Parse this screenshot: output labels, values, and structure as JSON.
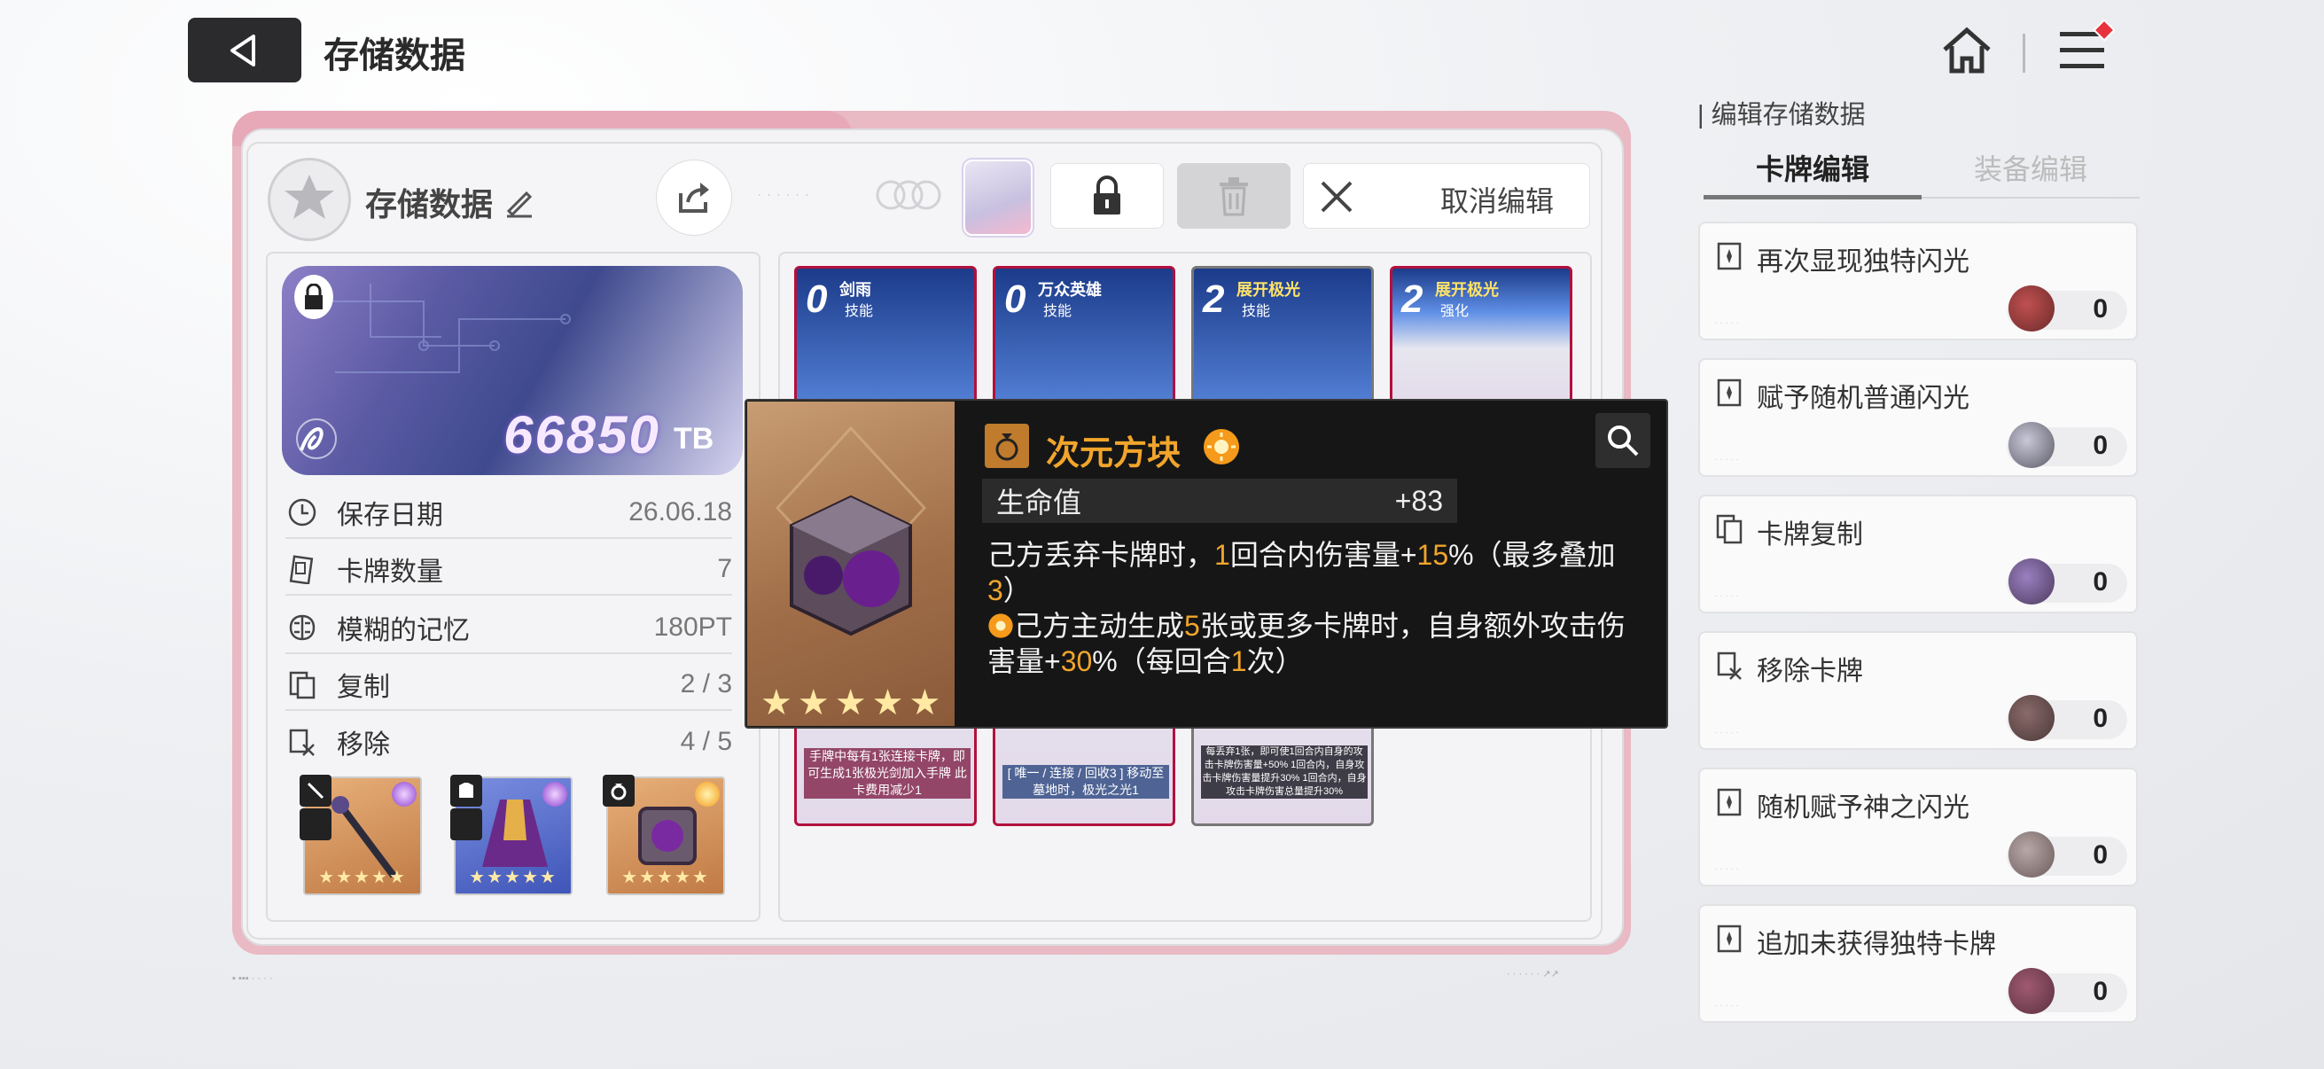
{
  "header": {
    "title": "存储数据"
  },
  "panel": {
    "save_name": "存储数据",
    "cancel_edit": "取消编辑"
  },
  "banner": {
    "value": "66850",
    "unit": "TB"
  },
  "stats": [
    {
      "label": "保存日期",
      "value": "26.06.18",
      "icon": "clock-icon"
    },
    {
      "label": "卡牌数量",
      "value": "7",
      "icon": "cards-icon"
    },
    {
      "label": "模糊的记忆",
      "value": "180PT",
      "icon": "brain-icon"
    },
    {
      "label": "复制",
      "value": "2 / 3",
      "icon": "copy-icon"
    },
    {
      "label": "移除",
      "value": "4 / 5",
      "icon": "remove-icon"
    }
  ],
  "equipment": [
    {
      "name": "staff",
      "stars": "★★★★★"
    },
    {
      "name": "robe",
      "stars": "★★★★★"
    },
    {
      "name": "cube",
      "stars": "★★★★★"
    }
  ],
  "cards": [
    {
      "cost": "0",
      "name": "剑雨",
      "type": "技能",
      "desc": "手牌中每有1张连接卡牌，即可生成1张极光剑加入手牌 此卡费用减少1"
    },
    {
      "cost": "0",
      "name": "万众英雄",
      "type": "技能",
      "desc": "[ 唯一 / 连接 / 回收3 ] 移动至墓地时，极光之光1"
    },
    {
      "cost": "2",
      "name": "展开极光",
      "type": "技能",
      "desc": "每丢弃1张，即可使1回合内自身的攻击卡牌伤害量+50% 1回合内，自身攻击卡牌伤害量提升30% 1回合内，自身攻击卡牌伤害总量提升30%"
    },
    {
      "cost": "2",
      "name": "展开极光",
      "type": "强化",
      "desc": ""
    }
  ],
  "tooltip": {
    "name": "次元方块",
    "stars": "★★★★★",
    "stat_label": "生命值",
    "stat_value": "+83",
    "line1_a": "己方丢弃卡牌时，",
    "line1_n1": "1",
    "line1_b": "回合内伤害量+",
    "line1_n2": "15",
    "line1_c": "%（最多叠加",
    "line1_n3": "3",
    "line1_d": "）",
    "line2_a": "己方主动生成",
    "line2_n1": "5",
    "line2_b": "张或更多卡牌时，自身额外攻击伤害量+",
    "line2_n2": "30",
    "line2_c": "%（每回合",
    "line2_n3": "1",
    "line2_d": "次）"
  },
  "right_panel": {
    "title": "编辑存储数据",
    "tab_active": "卡牌编辑",
    "tab_inactive": "装备编辑",
    "options": [
      {
        "label": "再次显现独特闪光",
        "count": "0",
        "gem": "#6b2a2a"
      },
      {
        "label": "赋予随机普通闪光",
        "count": "0",
        "gem": "#5a5a66"
      },
      {
        "label": "卡牌复制",
        "count": "0",
        "gem": "#4c3a5e"
      },
      {
        "label": "移除卡牌",
        "count": "0",
        "gem": "#4a3838"
      },
      {
        "label": "随机赋予神之闪光",
        "count": "0",
        "gem": "#6a5a5a"
      },
      {
        "label": "追加未获得独特卡牌",
        "count": "0",
        "gem": "#5a3040"
      }
    ]
  },
  "colors": {
    "accent_orange": "#f1a52b",
    "frame_pink": "#e9b9c4",
    "card_border": "#b3103d"
  }
}
